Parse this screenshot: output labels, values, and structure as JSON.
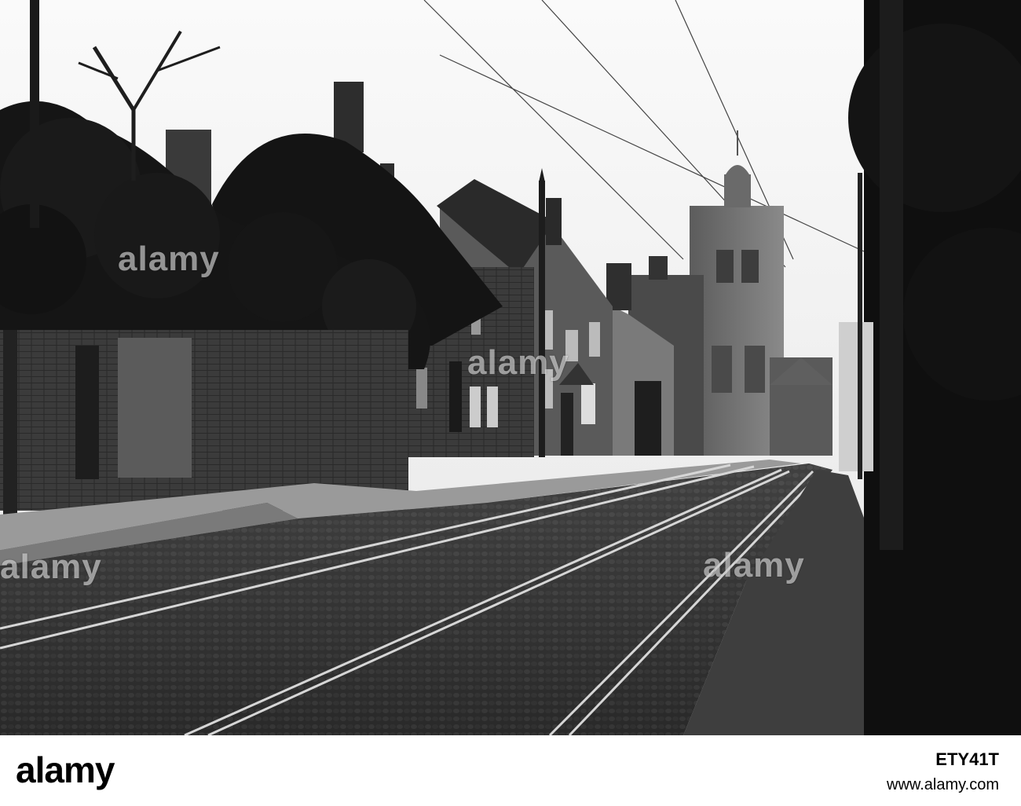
{
  "watermark": {
    "text": "alamy"
  },
  "footer": {
    "logo_text": "alamy",
    "image_id": "ETY41T",
    "site_url": "www.alamy.com"
  },
  "colors": {
    "sky": "#f2f2f2",
    "foliage": "#151515",
    "brick": "#3a3a3a",
    "cobbles": "#2c2c2c",
    "rails": "#cfcfcf",
    "tower": "#6e6e6e"
  }
}
